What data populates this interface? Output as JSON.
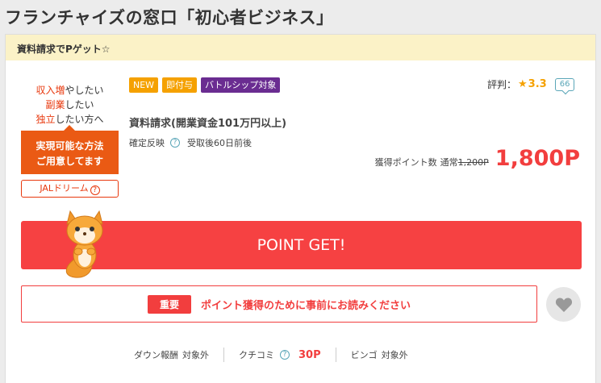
{
  "page": {
    "title": "フランチャイズの窓口「初心者ビジネス」"
  },
  "promo": {
    "text": "資料請求でPゲット☆"
  },
  "ad": {
    "line1_em": "収入増",
    "line1_rest": "やしたい",
    "line2_em": "副業",
    "line2_rest": "したい",
    "line3_em": "独立",
    "line3_rest": "したい方へ",
    "cta_line1": "実現可能な方法",
    "cta_line2": "ご用意してます",
    "link_label": "JALドリーム",
    "link_icon": "?"
  },
  "tags": {
    "new": "NEW",
    "instant": "即付与",
    "battle": "バトルシップ対象"
  },
  "rating": {
    "label": "評判：",
    "star": "★",
    "score": "3.3",
    "reviews": "66"
  },
  "offer": {
    "title": "資料請求(開業資金101万円以上)",
    "confirm_label": "確定反映",
    "confirm_value": "受取後60日前後",
    "help_icon": "?",
    "points_label": "獲得ポイント数",
    "normal_label": "通常",
    "normal_points": "1,200P",
    "points": "1,800P"
  },
  "point_get": {
    "label": "POINT GET!"
  },
  "notice": {
    "badge": "重要",
    "message": "ポイント獲得のために事前にお読みください"
  },
  "footer": {
    "down_label": "ダウン報酬",
    "down_value": "対象外",
    "review_label": "クチコミ",
    "review_points": "30P",
    "help_icon": "?",
    "bingo_label": "ビンゴ",
    "bingo_value": "対象外"
  },
  "colors": {
    "accent": "#f64142",
    "banner": "#fbf2c7",
    "tag_orange": "#f5a100",
    "tag_purple": "#6a2c91"
  }
}
